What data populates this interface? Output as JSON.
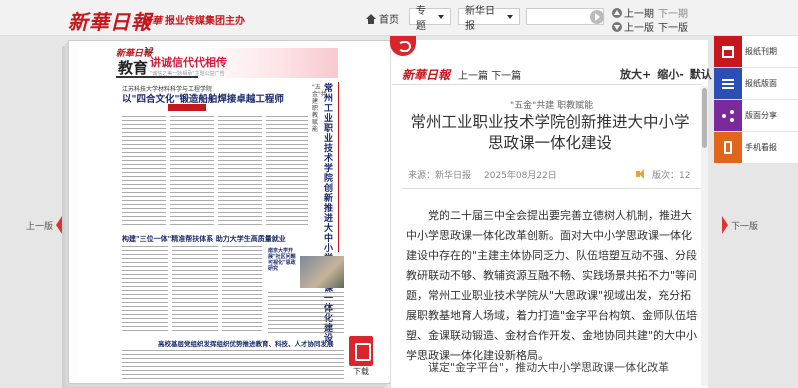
{
  "header": {
    "logo": "新華日報",
    "sub_logo_mark": "新華",
    "sub_logo_text": "报业传媒集团主办",
    "home_label": "首页",
    "topic_label": "专题",
    "paper_label": "新华日报",
    "search_placeholder": "",
    "prev_page": "上一期",
    "next_page": "下一期",
    "prev_edition": "上一版",
    "next_edition": "下一版"
  },
  "side_nav": {
    "prev": "上一版",
    "next": "下一版"
  },
  "paper_page": {
    "masthead": "新華日報",
    "page_no": "12",
    "section": "教育",
    "ad_title": "讲诚信代代相传",
    "ad_sub": "\"诚信之美一脉相承\"主题公益广告",
    "kicker": "江苏科技大学材料科学与工程学院",
    "headline": "以\"四合文化\"锻造船舶焊接卓越工程师",
    "vertical_headline": "常州工业职业技术学院创新推进大中小学思政课一体化建设",
    "vertical_sub": "\"五金\"共建职教赋能",
    "headline2": "构建\"三位一体\"精准帮扶体系 助力大学生高质量就业",
    "small_story": "南京大学开展\"社区问题可视化\"思政研究",
    "headline3": "高校基层党组织发挥组织优势推进教育、科技、人才协同发展",
    "pdf_label": "下载"
  },
  "article": {
    "logo": "新華日報",
    "nav": "上一篇 下一篇",
    "zoom_in": "放大+",
    "zoom_out": "缩小-",
    "zoom_default": "默认",
    "kicker": "\"五金\"共建 职教赋能",
    "title": "常州工业职业技术学院创新推进大中小学思政课一体化建设",
    "source": "来源：新华日报",
    "date": "2025年08月22日",
    "edition": "版次：12",
    "body": "党的二十届三中全会提出要完善立德树人机制，推进大中小学思政课一体化改革创新。面对大中小学思政课一体化建设中存在的\"主建主体协同乏力、队伍培塑互动不强、分段教研联动不够、教辅资源互融不畅、实践场景共拓不力\"等问题，常州工业职业技术学院从\"大思政课\"视域出发，充分拓展职教基地育人场域，着力打造\"金字平台构筑、金师队伍培塑、金课联动锻造、金材合作开发、金地协同共建\"的大中小学思政课一体化建设新格局。",
    "body2": "谋定\"金字平台\"，推动大中小学思政课一体化改革"
  },
  "tools": [
    {
      "label": "报纸刊期",
      "icon": "calendar-icon"
    },
    {
      "label": "报纸版面",
      "icon": "list-icon"
    },
    {
      "label": "版面分享",
      "icon": "share-icon"
    },
    {
      "label": "手机看报",
      "icon": "phone-icon"
    }
  ]
}
